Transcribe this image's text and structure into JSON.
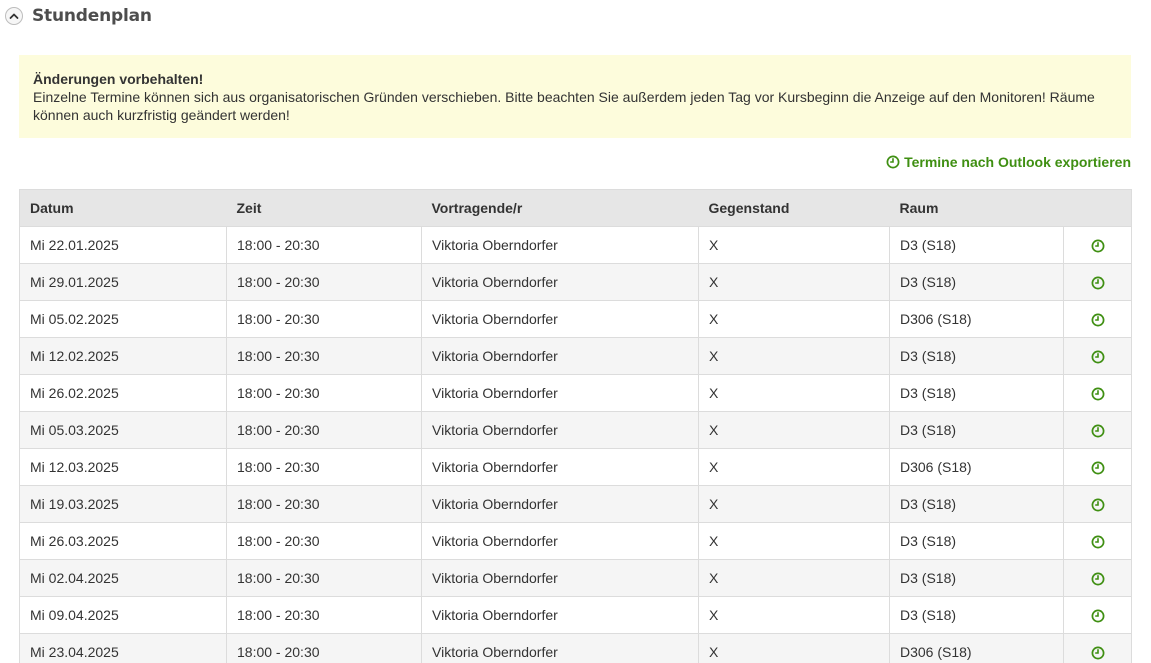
{
  "section": {
    "title": "Stundenplan",
    "toggle_icon": "chevron-up-icon"
  },
  "notice": {
    "title": "Änderungen vorbehalten!",
    "text": "Einzelne Termine können sich aus organisatorischen Gründen verschieben. Bitte beachten Sie außerdem jeden Tag vor Kursbeginn die Anzeige auf den Monitoren! Räume können auch kurzfristig geändert werden!"
  },
  "export": {
    "label": "Termine nach Outlook exportieren",
    "icon": "clock-icon",
    "color": "#3f8f12"
  },
  "table": {
    "headers": {
      "datum": "Datum",
      "zeit": "Zeit",
      "vortragende": "Vortragende/r",
      "gegenstand": "Gegenstand",
      "raum": "Raum",
      "export": ""
    },
    "rows": [
      {
        "datum": "Mi 22.01.2025",
        "zeit": "18:00 - 20:30",
        "vortragende": "Viktoria Oberndorfer",
        "gegenstand": "X",
        "raum": "D3 (S18)"
      },
      {
        "datum": "Mi 29.01.2025",
        "zeit": "18:00 - 20:30",
        "vortragende": "Viktoria Oberndorfer",
        "gegenstand": "X",
        "raum": "D3 (S18)"
      },
      {
        "datum": "Mi 05.02.2025",
        "zeit": "18:00 - 20:30",
        "vortragende": "Viktoria Oberndorfer",
        "gegenstand": "X",
        "raum": "D306 (S18)"
      },
      {
        "datum": "Mi 12.02.2025",
        "zeit": "18:00 - 20:30",
        "vortragende": "Viktoria Oberndorfer",
        "gegenstand": "X",
        "raum": "D3 (S18)"
      },
      {
        "datum": "Mi 26.02.2025",
        "zeit": "18:00 - 20:30",
        "vortragende": "Viktoria Oberndorfer",
        "gegenstand": "X",
        "raum": "D3 (S18)"
      },
      {
        "datum": "Mi 05.03.2025",
        "zeit": "18:00 - 20:30",
        "vortragende": "Viktoria Oberndorfer",
        "gegenstand": "X",
        "raum": "D3 (S18)"
      },
      {
        "datum": "Mi 12.03.2025",
        "zeit": "18:00 - 20:30",
        "vortragende": "Viktoria Oberndorfer",
        "gegenstand": "X",
        "raum": "D306 (S18)"
      },
      {
        "datum": "Mi 19.03.2025",
        "zeit": "18:00 - 20:30",
        "vortragende": "Viktoria Oberndorfer",
        "gegenstand": "X",
        "raum": "D3 (S18)"
      },
      {
        "datum": "Mi 26.03.2025",
        "zeit": "18:00 - 20:30",
        "vortragende": "Viktoria Oberndorfer",
        "gegenstand": "X",
        "raum": "D3 (S18)"
      },
      {
        "datum": "Mi 02.04.2025",
        "zeit": "18:00 - 20:30",
        "vortragende": "Viktoria Oberndorfer",
        "gegenstand": "X",
        "raum": "D3 (S18)"
      },
      {
        "datum": "Mi 09.04.2025",
        "zeit": "18:00 - 20:30",
        "vortragende": "Viktoria Oberndorfer",
        "gegenstand": "X",
        "raum": "D3 (S18)"
      },
      {
        "datum": "Mi 23.04.2025",
        "zeit": "18:00 - 20:30",
        "vortragende": "Viktoria Oberndorfer",
        "gegenstand": "X",
        "raum": "D306 (S18)"
      }
    ],
    "row_icon": "clock-icon"
  }
}
